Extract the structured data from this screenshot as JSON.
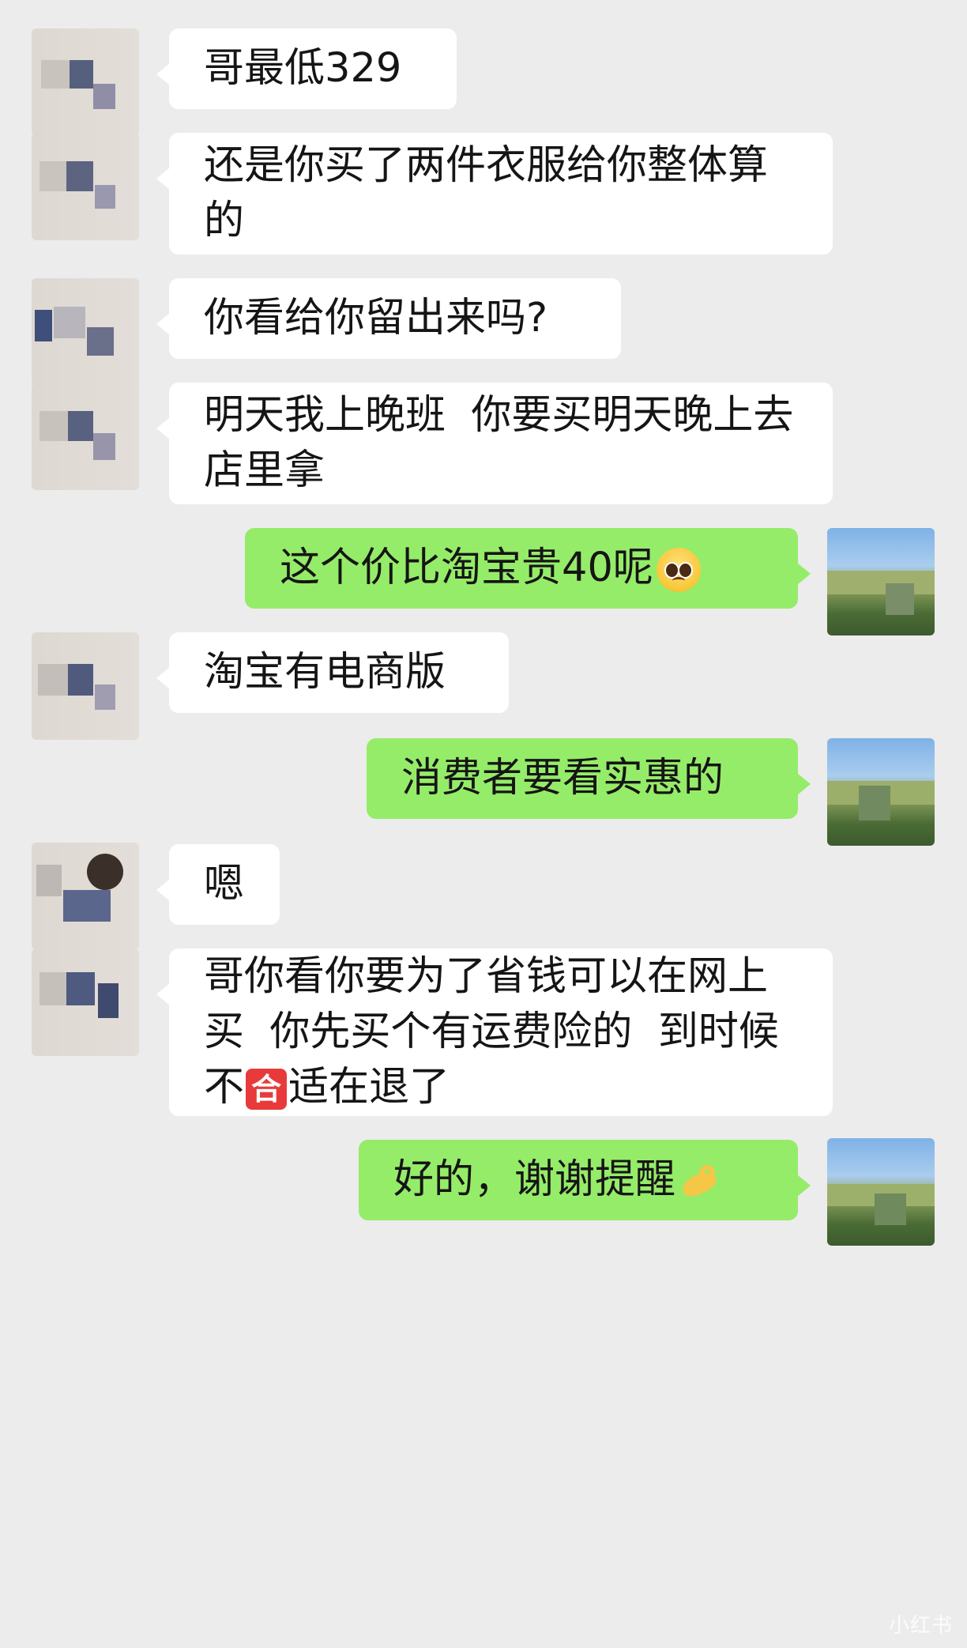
{
  "chat": {
    "messages": [
      {
        "side": "in",
        "text": "哥最低329"
      },
      {
        "side": "in",
        "text": "还是你买了两件衣服给你整体算的"
      },
      {
        "side": "in",
        "text": "你看给你留出来吗?"
      },
      {
        "side": "in",
        "text": "明天我上晚班  你要买明天晚上去店里拿"
      },
      {
        "side": "out",
        "text": "这个价比淘宝贵40呢",
        "emoji": "pleading-face-icon"
      },
      {
        "side": "in",
        "text": "淘宝有电商版"
      },
      {
        "side": "out",
        "text": "消费者要看实惠的"
      },
      {
        "side": "in",
        "text": "嗯"
      },
      {
        "side": "in",
        "text_before": "哥你看你要为了省钱可以在网上买  你先买个有运费险的  到时候不",
        "emoji": "he-acceptable-icon",
        "emoji_char": "合",
        "text_after": "适在退了"
      },
      {
        "side": "out",
        "text": "好的，谢谢提醒",
        "emoji": "ok-hand-icon"
      }
    ]
  },
  "watermark": "小红书"
}
